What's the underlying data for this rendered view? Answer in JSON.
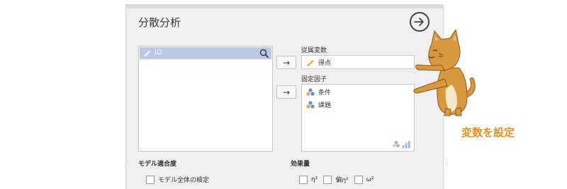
{
  "panel": {
    "title": "分散分析",
    "go_icon": "arrow-right-circle-icon"
  },
  "variables": {
    "items": [
      {
        "label": "ID",
        "icon": "pencil-ruler-icon"
      }
    ],
    "search_icon": "search-icon"
  },
  "move_button_label": "→",
  "dependent": {
    "label": "従属変数",
    "value": "得点",
    "icon": "pencil-ruler-icon"
  },
  "fixed_factors": {
    "label": "固定因子",
    "items": [
      {
        "label": "条件",
        "icon": "factor-nominal-icon"
      },
      {
        "label": "課題",
        "icon": "factor-nominal-icon"
      }
    ],
    "footer_icon": "factor-level-icon"
  },
  "model_fit": {
    "label": "モデル適合度",
    "options": [
      {
        "label": "モデル全体の検定",
        "checked": false
      }
    ]
  },
  "effect_size": {
    "label": "効果量",
    "options": [
      {
        "label": "η²",
        "checked": false
      },
      {
        "label": "偏η²",
        "checked": false
      },
      {
        "label": "ω²",
        "checked": false
      }
    ]
  },
  "annotation": {
    "caption": "変数を設定",
    "caption_color": "#e58f20",
    "character": "cat-pointing-illustration"
  },
  "colors": {
    "selection": "#b9c8e4",
    "panel": "#efefef"
  }
}
